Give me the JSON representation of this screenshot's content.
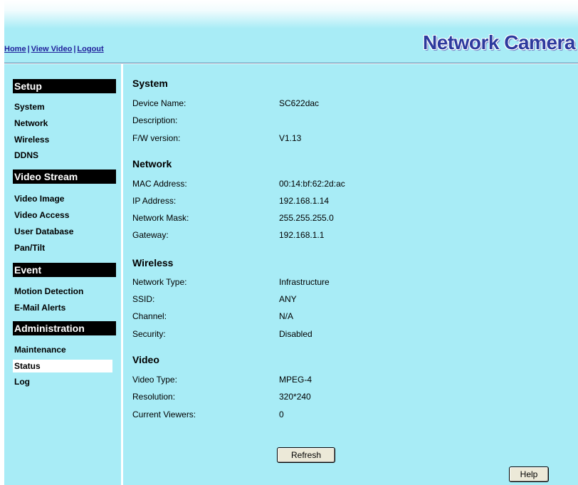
{
  "header": {
    "nav": [
      {
        "label": "Home"
      },
      {
        "label": "View Video"
      },
      {
        "label": "Logout"
      }
    ],
    "separator": "|",
    "brand": "Network Camera"
  },
  "sidebar": {
    "sections": [
      {
        "title": "Setup",
        "items": [
          "System",
          "Network",
          "Wireless",
          "DDNS"
        ]
      },
      {
        "title": "Video Stream",
        "items": [
          "Video Image",
          "Video Access",
          "User Database",
          "Pan/Tilt"
        ]
      },
      {
        "title": "Event",
        "items": [
          "Motion Detection",
          "E-Mail Alerts"
        ]
      },
      {
        "title": "Administration",
        "items": [
          "Maintenance",
          "Status",
          "Log"
        ]
      }
    ],
    "active_item": "Status"
  },
  "status": {
    "sections": [
      {
        "title": "System",
        "rows": [
          {
            "label": "Device Name:",
            "value": "SC622dac"
          },
          {
            "label": "Description:",
            "value": ""
          },
          {
            "label": "F/W version:",
            "value": "V1.13"
          }
        ]
      },
      {
        "title": "Network",
        "rows": [
          {
            "label": "MAC Address:",
            "value": "00:14:bf:62:2d:ac"
          },
          {
            "label": "IP Address:",
            "value": "192.168.1.14"
          },
          {
            "label": "Network Mask:",
            "value": "255.255.255.0"
          },
          {
            "label": "Gateway:",
            "value": "192.168.1.1"
          }
        ]
      },
      {
        "title": "Wireless",
        "rows": [
          {
            "label": "Network Type:",
            "value": "Infrastructure"
          },
          {
            "label": "SSID:",
            "value": "ANY"
          },
          {
            "label": "Channel:",
            "value": "N/A"
          },
          {
            "label": "Security:",
            "value": "Disabled"
          }
        ]
      },
      {
        "title": "Video",
        "rows": [
          {
            "label": "Video Type:",
            "value": "MPEG-4"
          },
          {
            "label": "Resolution:",
            "value": "320*240"
          },
          {
            "label": "Current Viewers:",
            "value": "0"
          }
        ]
      }
    ]
  },
  "buttons": {
    "refresh": "Refresh",
    "help": "Help"
  },
  "colors": {
    "background": "#a8ecf6",
    "link": "#1f1f9a",
    "brand": "#2d3a9e",
    "section_header_bg": "#000000"
  }
}
